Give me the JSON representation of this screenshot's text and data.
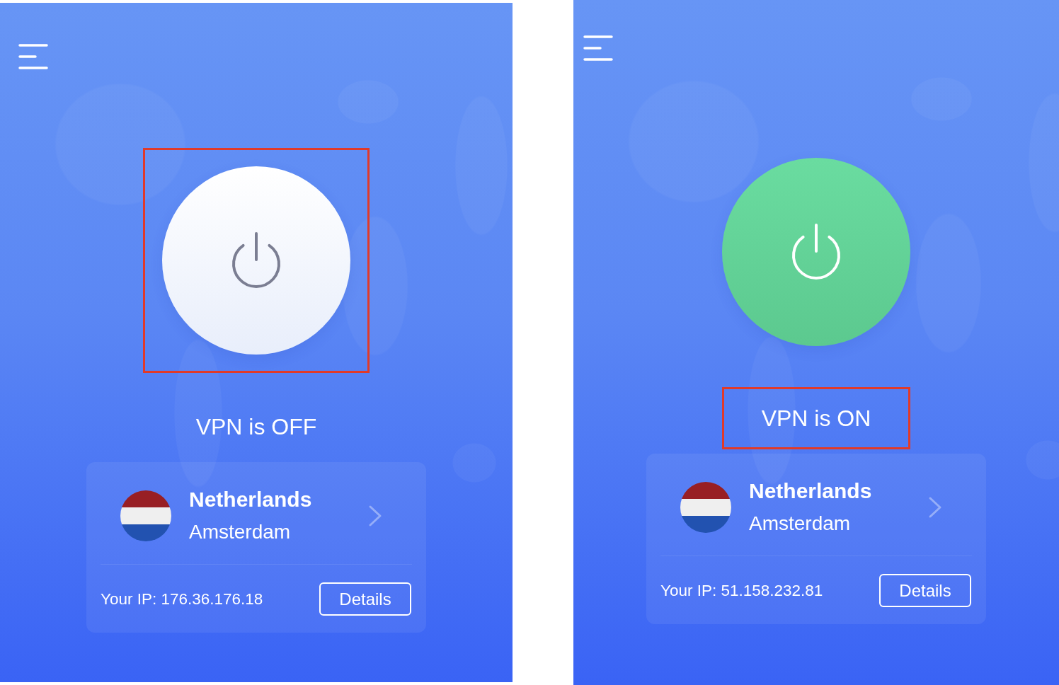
{
  "panels": [
    {
      "power_button": {
        "on": false,
        "highlighted": true
      },
      "status": {
        "text": "VPN is OFF",
        "highlighted": false
      },
      "location": {
        "country": "Netherlands",
        "city": "Amsterdam"
      },
      "ip": "Your IP: 176.36.176.18",
      "details_button": "Details"
    },
    {
      "power_button": {
        "on": true,
        "highlighted": false
      },
      "status": {
        "text": "VPN is ON",
        "highlighted": true
      },
      "location": {
        "country": "Netherlands",
        "city": "Amsterdam"
      },
      "ip": "Your IP: 51.158.232.81",
      "details_button": "Details"
    }
  ]
}
